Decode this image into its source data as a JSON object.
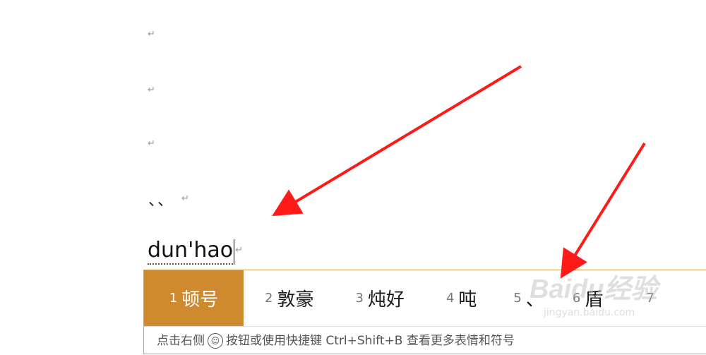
{
  "document": {
    "paragraph_mark": "↵",
    "line4_text": "、、",
    "composition_text": "dun'hao"
  },
  "ime": {
    "candidates": [
      {
        "num": "1",
        "text": "顿号",
        "selected": true
      },
      {
        "num": "2",
        "text": "敦豪"
      },
      {
        "num": "3",
        "text": "炖好"
      },
      {
        "num": "4",
        "text": "吨"
      },
      {
        "num": "5",
        "text": "、"
      },
      {
        "num": "6",
        "text": "盾"
      },
      {
        "num": "7",
        "text": ""
      }
    ],
    "hint_before": "点击右侧",
    "hint_after": "按钮或使用快捷键 Ctrl+Shift+B 查看更多表情和符号",
    "accent_color": "#cf892f",
    "border_color": "#d1a25c"
  },
  "annotation": {
    "arrow_color": "#ff1a1a"
  },
  "watermark": {
    "logo_text": "Baidu经验",
    "url": "jingyan.baidu.com"
  }
}
